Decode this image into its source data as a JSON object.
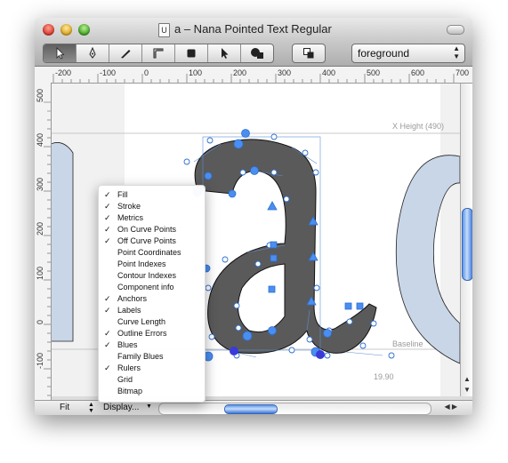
{
  "window": {
    "title": "a – Nana Pointed Text Regular",
    "doc_icon_letter": "U"
  },
  "toolbar": {
    "tools": [
      "select-pointer",
      "pen",
      "knife",
      "ruler",
      "rectangle",
      "arrow",
      "shapes",
      "layers"
    ],
    "layer_value": "foreground"
  },
  "rulers": {
    "h_labels": [
      "-200",
      "-100",
      "0",
      "100",
      "200",
      "300",
      "400",
      "500",
      "600",
      "700"
    ],
    "v_labels": [
      "500",
      "400",
      "300",
      "200",
      "100",
      "0",
      "-100"
    ]
  },
  "canvas": {
    "x_height_label": "X Height (490)",
    "baseline_label": "Baseline",
    "coord_label": "19.90",
    "glyph_char": "a"
  },
  "display_menu": {
    "items": [
      {
        "label": "Fill",
        "checked": true
      },
      {
        "label": "Stroke",
        "checked": true
      },
      {
        "label": "Metrics",
        "checked": true
      },
      {
        "label": "On Curve Points",
        "checked": true
      },
      {
        "label": "Off Curve Points",
        "checked": true
      },
      {
        "label": "Point Coordinates",
        "checked": false
      },
      {
        "label": "Point Indexes",
        "checked": false
      },
      {
        "label": "Contour Indexes",
        "checked": false
      },
      {
        "label": "Component info",
        "checked": false
      },
      {
        "label": "Anchors",
        "checked": true
      },
      {
        "label": "Labels",
        "checked": true
      },
      {
        "label": "Curve Length",
        "checked": false
      },
      {
        "label": "Outline Errors",
        "checked": true
      },
      {
        "label": "Blues",
        "checked": true
      },
      {
        "label": "Family Blues",
        "checked": false
      },
      {
        "label": "Rulers",
        "checked": true
      },
      {
        "label": "Grid",
        "checked": false
      },
      {
        "label": "Bitmap",
        "checked": false
      }
    ]
  },
  "statusbar": {
    "zoom": "Fit",
    "display_button": "Display..."
  },
  "colors": {
    "glyph_fill": "#5a5a5a",
    "neighbor_fill": "#c9d6e8",
    "point_blue": "#4a8ef0",
    "selection_blue": "#3a3ad8"
  },
  "icons": {
    "check": "✓",
    "up": "▲",
    "down": "▼",
    "left": "◀",
    "right": "▶",
    "updown": "⇕"
  }
}
